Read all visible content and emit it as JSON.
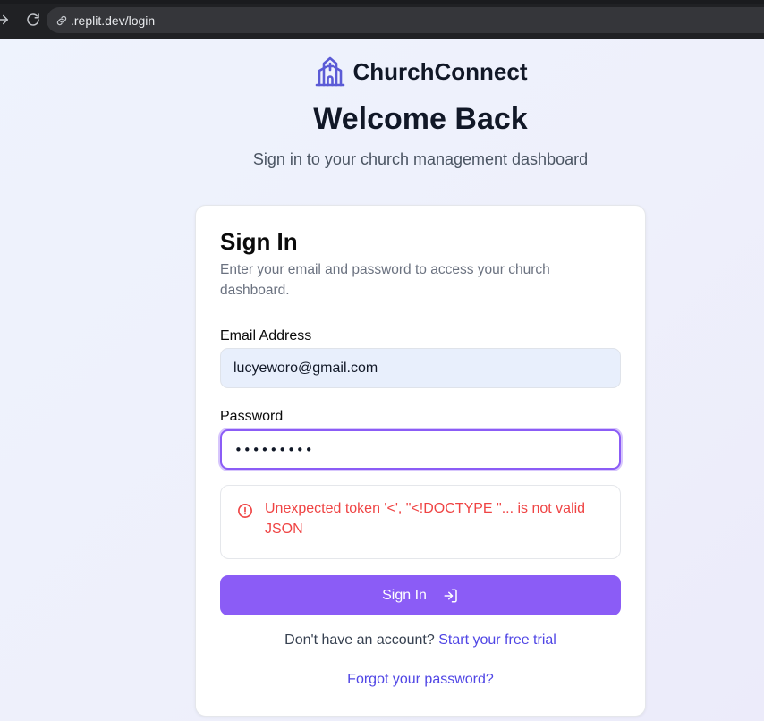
{
  "browser": {
    "url": ".replit.dev/login"
  },
  "header": {
    "brand_name": "ChurchConnect",
    "title": "Welcome Back",
    "subtitle": "Sign in to your church management dashboard"
  },
  "card": {
    "title": "Sign In",
    "description": "Enter your email and password to access your church dashboard.",
    "email": {
      "label": "Email Address",
      "value": "lucyeworo@gmail.com"
    },
    "password": {
      "label": "Password",
      "value": "•••••••••"
    },
    "error": {
      "message": "Unexpected token '<', \"<!DOCTYPE \"... is not valid JSON"
    },
    "submit_label": "Sign In",
    "signup_prompt": "Don't have an account?",
    "signup_link": "Start your free trial",
    "forgot_link": "Forgot your password?"
  },
  "colors": {
    "accent": "#8b5cf6",
    "brand_icon": "#5b5bd6",
    "link": "#5046e5",
    "error": "#ef4444"
  },
  "icons": {
    "forward": "arrow-right-icon",
    "reload": "reload-icon",
    "url_link": "link-icon",
    "brand": "church-icon",
    "error": "alert-circle-icon",
    "submit": "log-in-icon"
  }
}
